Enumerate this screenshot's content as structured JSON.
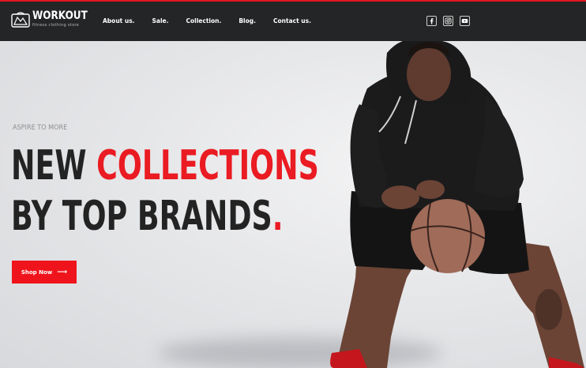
{
  "brand": {
    "name": "WORKOUT",
    "tagline": "fitness clothing store"
  },
  "nav": [
    "About us.",
    "Sale.",
    "Collection.",
    "Blog.",
    "Contact us."
  ],
  "social": [
    "facebook-icon",
    "instagram-icon",
    "youtube-icon"
  ],
  "hero": {
    "eyebrow": "ASPIRE TO MORE",
    "line1_dark": "NEW ",
    "line1_red": "COLLECTIONS",
    "line2_dark": "BY TOP BRANDS",
    "line2_dot": ".",
    "cta_label": "Shop Now",
    "cta_arrow": "⟶"
  },
  "colors": {
    "accent": "#e4161f",
    "header_bg": "#242526",
    "headline": "#232323"
  }
}
